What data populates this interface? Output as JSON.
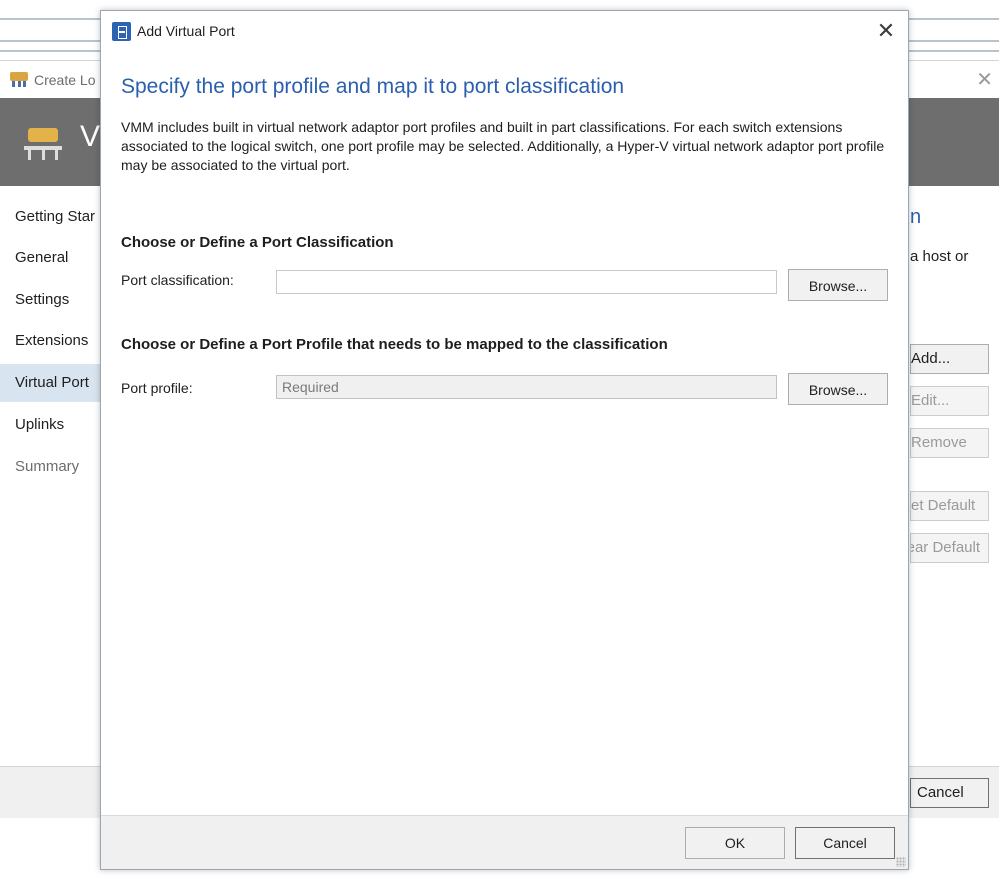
{
  "parent_window": {
    "title": "Create Lo",
    "banner_title": "Vi",
    "nav": [
      {
        "label": "Getting Star",
        "state": "normal"
      },
      {
        "label": "General",
        "state": "normal"
      },
      {
        "label": "Settings",
        "state": "normal"
      },
      {
        "label": "Extensions",
        "state": "normal"
      },
      {
        "label": "Virtual Port",
        "state": "active"
      },
      {
        "label": "Uplinks",
        "state": "normal"
      },
      {
        "label": "Summary",
        "state": "disabled"
      }
    ],
    "right_heading": "n",
    "right_text": "a host or",
    "buttons": {
      "add": "Add...",
      "edit": "Edit...",
      "remove": "Remove",
      "set_default": "et Default",
      "clear_default": "ear Default"
    },
    "cancel_label": "Cancel",
    "colors": {
      "banner": "#6e6e6e",
      "active_nav": "#d8e4f0"
    }
  },
  "dialog": {
    "title": "Add Virtual Port",
    "heading": "Specify the port profile and map it to port classification",
    "description": "VMM includes built in virtual network adaptor port profiles and built in part classifications. For each switch extensions associated to the logical switch, one port profile may be selected. Additionally, a Hyper-V virtual network adaptor port profile may be associated to the virtual port.",
    "classification_section": {
      "title": "Choose or Define a Port Classification",
      "label": "Port classification:",
      "value": "",
      "placeholder": "",
      "browse_label": "Browse..."
    },
    "profile_section": {
      "title": "Choose or Define a Port Profile that needs to be mapped to the classification",
      "label": "Port profile:",
      "value": "",
      "placeholder": "Required",
      "browse_label": "Browse..."
    },
    "footer": {
      "ok_label": "OK",
      "cancel_label": "Cancel"
    },
    "colors": {
      "heading": "#2b5fad",
      "icon": "#2c63b2"
    }
  }
}
